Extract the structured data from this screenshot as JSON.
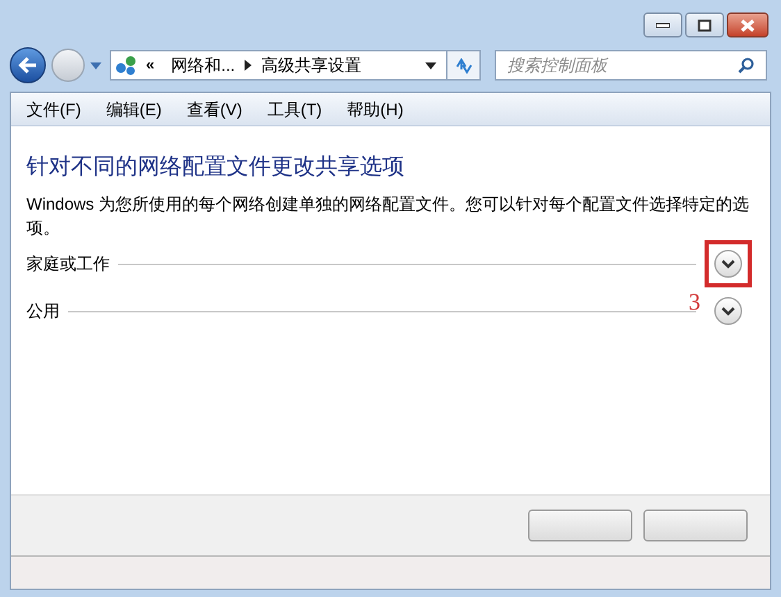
{
  "address_bar": {
    "overflow": "«",
    "segments": [
      "网络和...",
      "高级共享设置"
    ]
  },
  "search": {
    "placeholder": "搜索控制面板"
  },
  "menu": [
    "文件(F)",
    "编辑(E)",
    "查看(V)",
    "工具(T)",
    "帮助(H)"
  ],
  "content": {
    "heading": "针对不同的网络配置文件更改共享选项",
    "description": "Windows 为您所使用的每个网络创建单独的网络配置文件。您可以针对每个配置文件选择特定的选项。",
    "profiles": [
      {
        "label": "家庭或工作",
        "expanded": false,
        "highlighted": true
      },
      {
        "label": "公用",
        "expanded": false,
        "highlighted": false
      }
    ]
  },
  "annotation": {
    "text": "3"
  }
}
